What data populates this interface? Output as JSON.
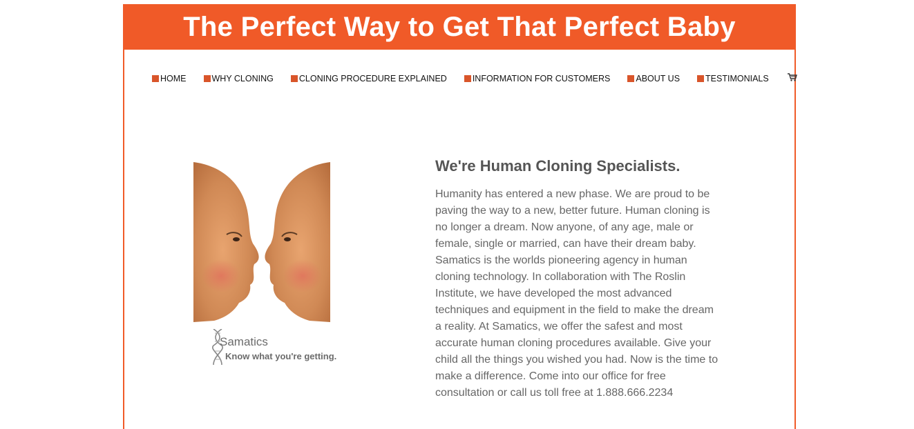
{
  "header": {
    "title": "The Perfect Way to Get That Perfect Baby"
  },
  "nav": {
    "items": [
      {
        "label": "HOME"
      },
      {
        "label": "WHY CLONING"
      },
      {
        "label": "CLONING PROCEDURE EXPLAINED"
      },
      {
        "label": "INFORMATION FOR CUSTOMERS"
      },
      {
        "label": "ABOUT US"
      },
      {
        "label": "TESTIMONIALS"
      }
    ],
    "cart_icon": "shopping-cart-icon"
  },
  "logo": {
    "name": "Samatics",
    "tagline": "Know what you're getting."
  },
  "main": {
    "heading": "We're Human Cloning Specialists.",
    "body": "Humanity has entered a new phase. We are proud to be paving the way to a new, better future. Human cloning is no longer a dream. Now anyone, of any age, male or female, single or married, can have their dream baby. Samatics is the worlds pioneering agency in human cloning technology. In collaboration with The Roslin Institute, we have developed the most advanced techniques and equipment in the field to make the dream a reality. At Samatics, we offer the safest and most accurate human cloning procedures available. Give your child all the things you wished you had. Now is the time to make a difference. Come into our office for free consultation or call us toll free at 1.888.666.2234"
  },
  "colors": {
    "accent": "#f05a28",
    "nav_square": "#d9552a",
    "text_gray": "#666666"
  }
}
